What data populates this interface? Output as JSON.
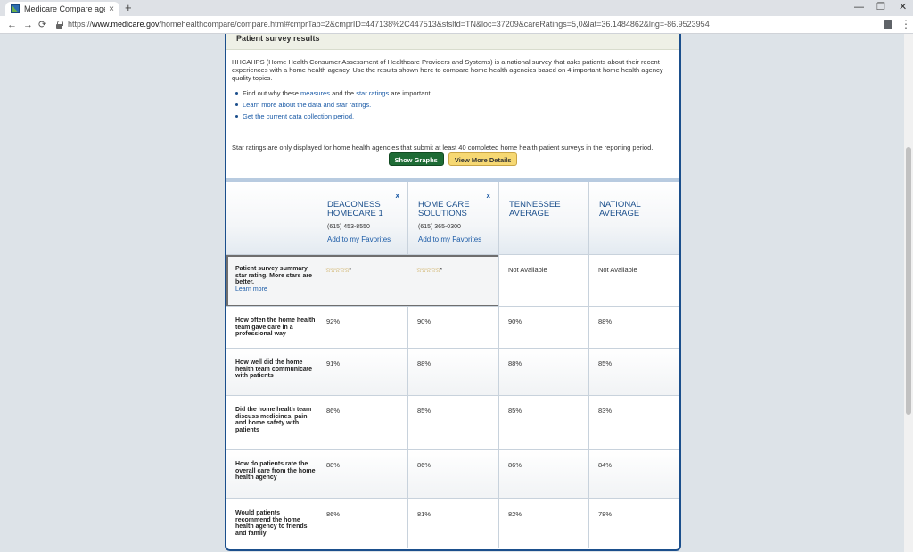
{
  "browser": {
    "tab_title": "Medicare Compare agencies",
    "tab_close": "×",
    "new_tab": "+",
    "url_scheme": "https://",
    "url_host": "www.medicare.gov",
    "url_path": "/homehealthcompare/compare.html#cmprTab=2&cmprID=447138%2C447513&stsltd=TN&loc=37209&careRatings=5,0&lat=36.1484862&lng=-86.9523954",
    "minimize": "—",
    "restore": "❐",
    "close": "✕",
    "back": "←",
    "forward": "→",
    "reload": "⟳",
    "menu": "⋮"
  },
  "section": {
    "title": "Patient survey results",
    "intro": "HHCAHPS (Home Health Consumer Assessment of Healthcare Providers and Systems) is a national survey that asks patients about their recent experiences with a home health agency. Use the results shown here to compare home health agencies based on 4 important home health agency quality topics.",
    "bullet1_pre": "Find out why these ",
    "bullet1_link1": "measures",
    "bullet1_mid": " and the ",
    "bullet1_link2": "star ratings",
    "bullet1_post": " are important.",
    "bullet2": "Learn more about the data and star ratings.",
    "bullet3": "Get the current data collection period.",
    "note": "Star ratings are only displayed for home health agencies that submit at least 40 completed home health patient surveys in the reporting period.",
    "show_graphs": "Show Graphs",
    "view_more": "View More Details"
  },
  "columns": [
    {
      "name": "DEACONESS HOMECARE 1",
      "phone": "(615) 453-8550",
      "favorite": "Add to my Favorites",
      "remove": "x"
    },
    {
      "name": "HOME CARE SOLUTIONS",
      "phone": "(615) 365-0300",
      "favorite": "Add to my Favorites",
      "remove": "x"
    },
    {
      "name": "TENNESSEE AVERAGE"
    },
    {
      "name": "NATIONAL AVERAGE"
    }
  ],
  "star_row": {
    "label": "Patient survey summary star rating. More stars are better.",
    "learn_more": "Learn more",
    "stars": "☆☆☆☆☆",
    "asterisk": "*",
    "tn": "Not Available",
    "nat": "Not Available"
  },
  "rows": [
    {
      "label": "How often the home health team gave care in a professional way",
      "values": [
        "92%",
        "90%",
        "90%",
        "88%"
      ]
    },
    {
      "label": "How well did the home health team communicate with patients",
      "values": [
        "91%",
        "88%",
        "88%",
        "85%"
      ]
    },
    {
      "label": "Did the home health team discuss medicines, pain, and home safety with patients",
      "values": [
        "86%",
        "85%",
        "85%",
        "83%"
      ]
    },
    {
      "label": "How do patients rate the overall care from the home health agency",
      "values": [
        "88%",
        "86%",
        "86%",
        "84%"
      ]
    },
    {
      "label": "Would patients recommend the home health agency to friends and family",
      "values": [
        "86%",
        "81%",
        "82%",
        "78%"
      ]
    }
  ]
}
